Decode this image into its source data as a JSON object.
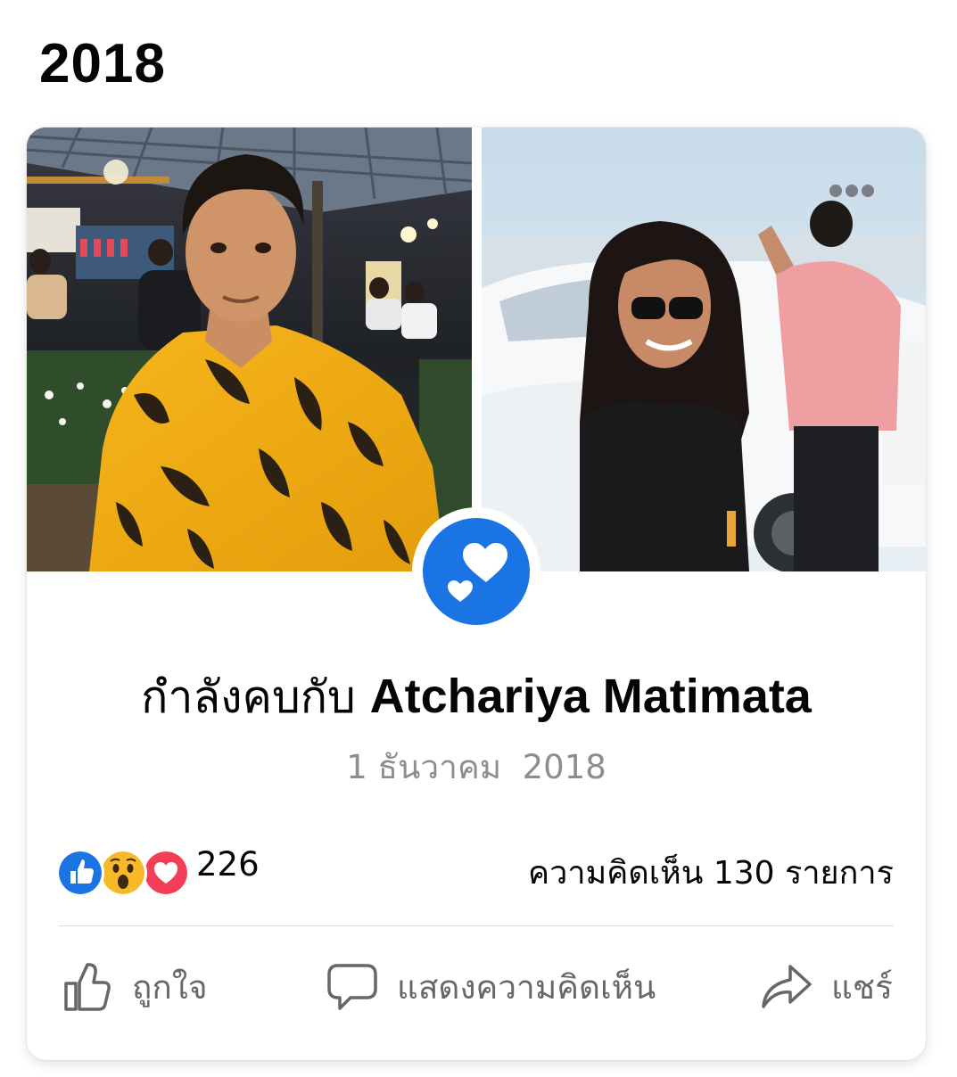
{
  "header": {
    "year": "2018"
  },
  "event": {
    "prefix": "กำลังคบกับ ",
    "name": "Atchariya Matimata",
    "date": "1 ธันวาคม  2018"
  },
  "stats": {
    "reaction_icons": [
      "like-reaction",
      "wow-reaction",
      "love-reaction"
    ],
    "reaction_count": "226",
    "comments_label": "ความคิดเห็น 130 รายการ"
  },
  "actions": {
    "like_label": "ถูกใจ",
    "comment_label": "แสดงความคิดเห็น",
    "share_label": "แชร์"
  },
  "colors": {
    "brand_blue": "#1b74e4",
    "muted_text": "#65676b",
    "date_text": "#8a8d91",
    "love_red": "#f33e58"
  }
}
